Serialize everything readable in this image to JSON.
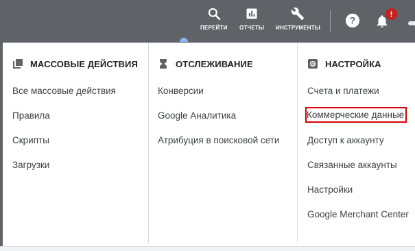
{
  "toolbar": {
    "go_label": "ПЕРЕЙТИ",
    "reports_label": "ОТЧЕТЫ",
    "tools_label": "ИНСТРУМЕНТЫ",
    "notification_badge": "!"
  },
  "columns": [
    {
      "title": "МАССОВЫЕ ДЕЙСТВИЯ",
      "icon": "bulk-actions-icon",
      "items": [
        "Все массовые действия",
        "Правила",
        "Скрипты",
        "Загрузки"
      ]
    },
    {
      "title": "ОТСЛЕЖИВАНИЕ",
      "icon": "hourglass-icon",
      "items": [
        "Конверсии",
        "Google Аналитика",
        "Атрибуция в поисковой сети"
      ]
    },
    {
      "title": "НАСТРОЙКА",
      "icon": "settings-icon",
      "items": [
        "Счета и платежи",
        "Коммерческие данные",
        "Доступ к аккаунту",
        "Связанные аккаунты",
        "Настройки",
        "Google Merchant Center"
      ]
    }
  ],
  "highlighted_item": "Коммерческие данные",
  "colors": {
    "topbar": "#5f6368",
    "highlight_border": "#d50000",
    "badge": "#c5221f"
  }
}
